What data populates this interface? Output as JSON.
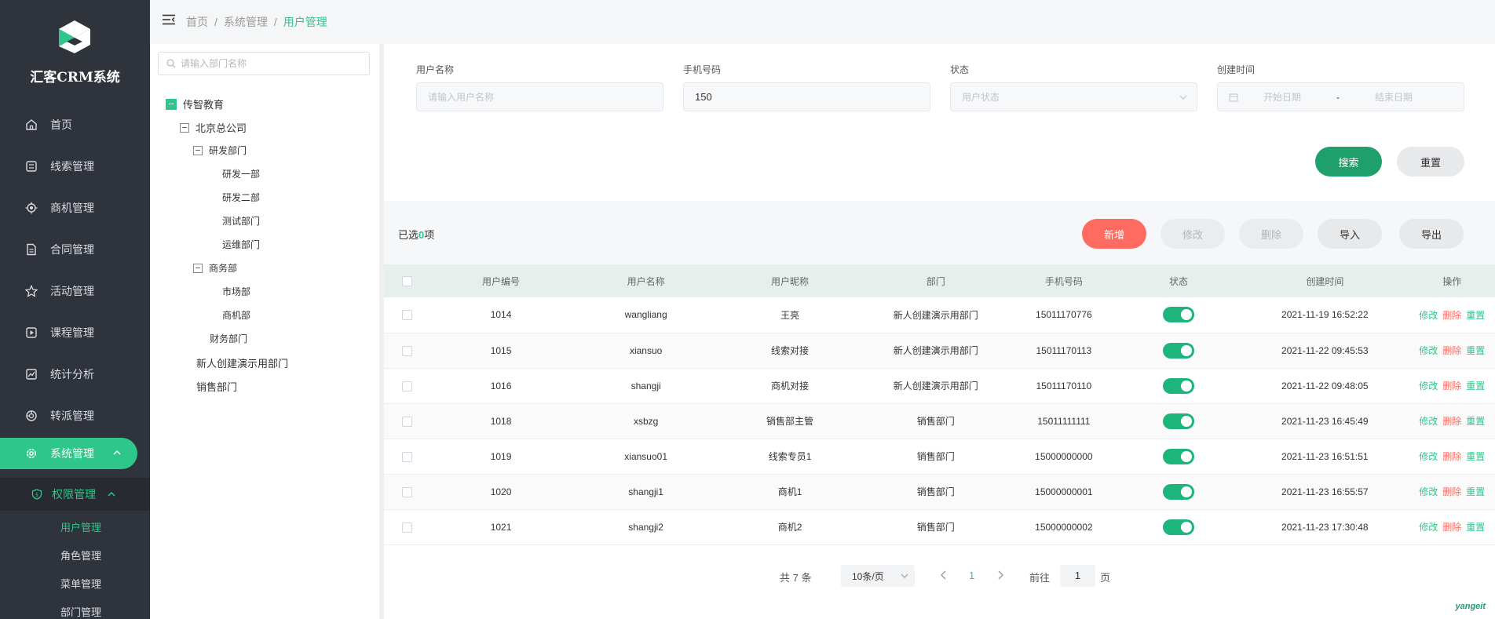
{
  "app": {
    "name": "汇客CRM系统"
  },
  "nav": {
    "items": [
      {
        "label": "首页",
        "icon": "home-icon"
      },
      {
        "label": "线索管理",
        "icon": "clue-icon"
      },
      {
        "label": "商机管理",
        "icon": "business-icon"
      },
      {
        "label": "合同管理",
        "icon": "contract-icon"
      },
      {
        "label": "活动管理",
        "icon": "activity-icon"
      },
      {
        "label": "课程管理",
        "icon": "course-icon"
      },
      {
        "label": "统计分析",
        "icon": "chart-icon"
      },
      {
        "label": "转派管理",
        "icon": "transfer-icon"
      },
      {
        "label": "系统管理",
        "icon": "gear-icon"
      }
    ],
    "sub_group": "权限管理",
    "sub_items": [
      "用户管理",
      "角色管理",
      "菜单管理",
      "部门管理"
    ]
  },
  "breadcrumb": {
    "home": "首页",
    "section": "系统管理",
    "current": "用户管理"
  },
  "tree": {
    "search_placeholder": "请输入部门名称",
    "root": "传智教育",
    "beijing": "北京总公司",
    "rd": "研发部门",
    "rd1": "研发一部",
    "rd2": "研发二部",
    "test": "测试部门",
    "ops": "运维部门",
    "biz": "商务部",
    "market": "市场部",
    "bizdept": "商机部",
    "finance": "财务部门",
    "demo": "新人创建演示用部门",
    "sales": "销售部门"
  },
  "filters": {
    "username_label": "用户名称",
    "username_placeholder": "请输入用户名称",
    "phone_label": "手机号码",
    "phone_value": "150",
    "status_label": "状态",
    "status_placeholder": "用户状态",
    "created_label": "创建时间",
    "start_placeholder": "开始日期",
    "range_sep": "-",
    "end_placeholder": "结束日期",
    "search_btn": "搜索",
    "reset_btn": "重置"
  },
  "toolbar": {
    "selected_prefix": "已选",
    "selected_count": "0",
    "selected_suffix": "项",
    "add": "新增",
    "edit": "修改",
    "delete": "删除",
    "import": "导入",
    "export": "导出"
  },
  "table": {
    "headers": [
      "用户编号",
      "用户名称",
      "用户昵称",
      "部门",
      "手机号码",
      "状态",
      "创建时间",
      "操作"
    ],
    "rows": [
      {
        "id": "1014",
        "username": "wangliang",
        "nickname": "王亮",
        "dept": "新人创建演示用部门",
        "phone": "15011170776",
        "status": true,
        "created": "2021-11-19 16:52:22"
      },
      {
        "id": "1015",
        "username": "xiansuo",
        "nickname": "线索对接",
        "dept": "新人创建演示用部门",
        "phone": "15011170113",
        "status": true,
        "created": "2021-11-22 09:45:53"
      },
      {
        "id": "1016",
        "username": "shangji",
        "nickname": "商机对接",
        "dept": "新人创建演示用部门",
        "phone": "15011170110",
        "status": true,
        "created": "2021-11-22 09:48:05"
      },
      {
        "id": "1018",
        "username": "xsbzg",
        "nickname": "销售部主管",
        "dept": "销售部门",
        "phone": "15011111111",
        "status": true,
        "created": "2021-11-23 16:45:49"
      },
      {
        "id": "1019",
        "username": "xiansuo01",
        "nickname": "线索专员1",
        "dept": "销售部门",
        "phone": "15000000000",
        "status": true,
        "created": "2021-11-23 16:51:51"
      },
      {
        "id": "1020",
        "username": "shangji1",
        "nickname": "商机1",
        "dept": "销售部门",
        "phone": "15000000001",
        "status": true,
        "created": "2021-11-23 16:55:57"
      },
      {
        "id": "1021",
        "username": "shangji2",
        "nickname": "商机2",
        "dept": "销售部门",
        "phone": "15000000002",
        "status": true,
        "created": "2021-11-23 17:30:48"
      }
    ],
    "op_edit": "修改",
    "op_delete": "删除",
    "op_reset": "重置"
  },
  "pager": {
    "total": "共 7 条",
    "page_size": "10条/页",
    "current": "1",
    "goto": "前往",
    "goto_value": "1",
    "page_unit": "页"
  },
  "watermark": "yangeit",
  "colors": {
    "accent": "#2fc68b",
    "danger": "#ff6b60",
    "sidebar": "#2f333b"
  }
}
